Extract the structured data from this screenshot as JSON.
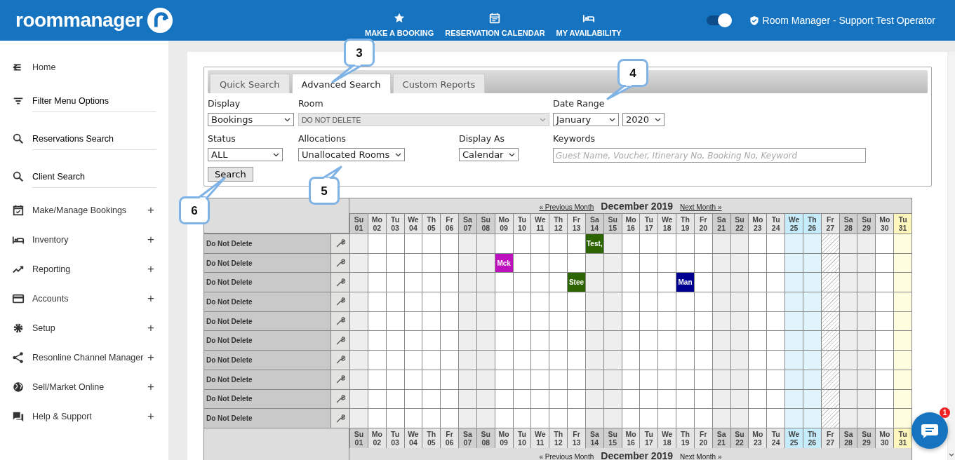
{
  "header": {
    "logo": "roommanager",
    "nav": [
      {
        "label": "MAKE A BOOKING"
      },
      {
        "label": "RESERVATION CALENDAR"
      },
      {
        "label": "MY AVAILABILITY"
      }
    ],
    "toggle": {
      "on": true
    },
    "user": "Room Manager - Support Test Operator"
  },
  "sidebar": {
    "items": [
      {
        "label": "Home",
        "kind": "plain"
      },
      {
        "label": "Filter Menu Options",
        "kind": "link"
      },
      {
        "label": "Reservations Search",
        "kind": "link"
      },
      {
        "label": "Client Search",
        "kind": "link"
      },
      {
        "label": "Make/Manage Bookings",
        "kind": "group",
        "toggle": "+"
      },
      {
        "label": "Inventory",
        "kind": "group",
        "toggle": "+"
      },
      {
        "label": "Reporting",
        "kind": "group",
        "toggle": "+"
      },
      {
        "label": "Accounts",
        "kind": "group",
        "toggle": "+"
      },
      {
        "label": "Setup",
        "kind": "group",
        "toggle": "+"
      },
      {
        "label": "Resonline Channel Manager",
        "kind": "group",
        "toggle": "+"
      },
      {
        "label": "Sell/Market Online",
        "kind": "group",
        "toggle": "+"
      },
      {
        "label": "Help & Support",
        "kind": "group",
        "toggle": "+"
      }
    ]
  },
  "tabs": [
    {
      "label": "Quick Search",
      "selected": false
    },
    {
      "label": "Advanced Search",
      "selected": true
    },
    {
      "label": "Custom Reports",
      "selected": false
    }
  ],
  "form": {
    "display": {
      "label": "Display",
      "value": "Bookings"
    },
    "room": {
      "label": "Room",
      "value": "DO NOT DELETE",
      "disabled": true
    },
    "date_range": {
      "label": "Date Range",
      "month": "January",
      "year": "2020"
    },
    "status": {
      "label": "Status",
      "value": "ALL"
    },
    "allocations": {
      "label": "Allocations",
      "value": "Unallocated Rooms"
    },
    "display_as": {
      "label": "Display As",
      "value": "Calendar"
    },
    "keywords": {
      "label": "Keywords",
      "placeholder": "Guest Name, Voucher, Itinerary No, Booking No, Keyword"
    },
    "search_button": "Search"
  },
  "calendar": {
    "nav_top": {
      "prev": "« Previous Month",
      "title": "December 2019",
      "next": "Next Month »"
    },
    "nav_bottom": {
      "prev": "« Previous Month",
      "title": "December 2019",
      "next": "Next Month »"
    },
    "days": [
      {
        "dow": "Su",
        "day": "01",
        "kind": "weekend"
      },
      {
        "dow": "Mo",
        "day": "02",
        "kind": "weekday"
      },
      {
        "dow": "Tu",
        "day": "03",
        "kind": "weekday"
      },
      {
        "dow": "We",
        "day": "04",
        "kind": "weekday"
      },
      {
        "dow": "Th",
        "day": "05",
        "kind": "weekday"
      },
      {
        "dow": "Fr",
        "day": "06",
        "kind": "weekday"
      },
      {
        "dow": "Sa",
        "day": "07",
        "kind": "weekend"
      },
      {
        "dow": "Su",
        "day": "08",
        "kind": "weekend"
      },
      {
        "dow": "Mo",
        "day": "09",
        "kind": "weekday"
      },
      {
        "dow": "Tu",
        "day": "10",
        "kind": "weekday"
      },
      {
        "dow": "We",
        "day": "11",
        "kind": "weekday"
      },
      {
        "dow": "Th",
        "day": "12",
        "kind": "weekday"
      },
      {
        "dow": "Fr",
        "day": "13",
        "kind": "weekday"
      },
      {
        "dow": "Sa",
        "day": "14",
        "kind": "weekend"
      },
      {
        "dow": "Su",
        "day": "15",
        "kind": "weekend"
      },
      {
        "dow": "Mo",
        "day": "16",
        "kind": "weekday"
      },
      {
        "dow": "Tu",
        "day": "17",
        "kind": "weekday"
      },
      {
        "dow": "We",
        "day": "18",
        "kind": "weekday"
      },
      {
        "dow": "Th",
        "day": "19",
        "kind": "weekday"
      },
      {
        "dow": "Fr",
        "day": "20",
        "kind": "weekday"
      },
      {
        "dow": "Sa",
        "day": "21",
        "kind": "weekend"
      },
      {
        "dow": "Su",
        "day": "22",
        "kind": "weekend"
      },
      {
        "dow": "Mo",
        "day": "23",
        "kind": "weekday"
      },
      {
        "dow": "Tu",
        "day": "24",
        "kind": "weekday"
      },
      {
        "dow": "We",
        "day": "25",
        "kind": "holiday"
      },
      {
        "dow": "Th",
        "day": "26",
        "kind": "holiday"
      },
      {
        "dow": "Fr",
        "day": "27",
        "kind": "closed"
      },
      {
        "dow": "Sa",
        "day": "28",
        "kind": "weekend"
      },
      {
        "dow": "Su",
        "day": "29",
        "kind": "weekend"
      },
      {
        "dow": "Mo",
        "day": "30",
        "kind": "weekday"
      },
      {
        "dow": "Tu",
        "day": "31",
        "kind": "today"
      }
    ],
    "footer_days": [
      {
        "dow": "Su",
        "day": "01"
      },
      {
        "dow": "Mo",
        "day": "02"
      },
      {
        "dow": "Tu",
        "day": "03"
      },
      {
        "dow": "We",
        "day": "04"
      },
      {
        "dow": "Th",
        "day": "05"
      },
      {
        "dow": "Fr",
        "day": "06"
      },
      {
        "dow": "Sa",
        "day": "07"
      },
      {
        "dow": "Su",
        "day": "08"
      },
      {
        "dow": "Mo",
        "day": "09"
      },
      {
        "dow": "Tu",
        "day": "10"
      },
      {
        "dow": "We",
        "day": "11"
      },
      {
        "dow": "Th",
        "day": "12"
      },
      {
        "dow": "Fr",
        "day": "13"
      },
      {
        "dow": "Sa",
        "day": "14"
      },
      {
        "dow": "Su",
        "day": "15"
      },
      {
        "dow": "Mo",
        "day": "16"
      },
      {
        "dow": "Tu",
        "day": "17"
      },
      {
        "dow": "We",
        "day": "18"
      },
      {
        "dow": "Th",
        "day": "19"
      },
      {
        "dow": "Fr",
        "day": "20"
      },
      {
        "dow": "Sa",
        "day": "21"
      },
      {
        "dow": "Su",
        "day": "22"
      },
      {
        "dow": "Mo",
        "day": "23"
      },
      {
        "dow": "Tu",
        "day": "24"
      },
      {
        "dow": "We",
        "day": "25"
      },
      {
        "dow": "Th",
        "day": "26"
      },
      {
        "dow": "Fr",
        "day": "27"
      },
      {
        "dow": "Sa",
        "day": "28"
      },
      {
        "dow": "Su",
        "day": "29"
      },
      {
        "dow": "Mo",
        "day": "30"
      },
      {
        "dow": "Tu",
        "day": "31"
      }
    ],
    "rows": [
      {
        "name": "Do Not Delete",
        "cells": [
          {
            "kind": "free"
          },
          {
            "kind": "free"
          },
          {
            "kind": "free"
          },
          {
            "kind": "free"
          },
          {
            "kind": "free"
          },
          {
            "kind": "free"
          },
          {
            "kind": "free"
          },
          {
            "kind": "free"
          },
          {
            "kind": "free"
          },
          {
            "kind": "free"
          },
          {
            "kind": "free"
          },
          {
            "kind": "free"
          },
          {
            "kind": "free"
          },
          {
            "kind": "booking",
            "label": "Test,",
            "color": "#2d6600"
          },
          {
            "kind": "free"
          },
          {
            "kind": "free"
          },
          {
            "kind": "free"
          },
          {
            "kind": "free"
          },
          {
            "kind": "free"
          },
          {
            "kind": "free"
          },
          {
            "kind": "free"
          },
          {
            "kind": "free"
          },
          {
            "kind": "free"
          },
          {
            "kind": "free"
          },
          {
            "kind": "free"
          },
          {
            "kind": "free"
          },
          {
            "kind": "free"
          },
          {
            "kind": "free"
          },
          {
            "kind": "free"
          },
          {
            "kind": "free"
          },
          {
            "kind": "free"
          }
        ]
      },
      {
        "name": "Do Not Delete",
        "cells": [
          {
            "kind": "free"
          },
          {
            "kind": "free"
          },
          {
            "kind": "free"
          },
          {
            "kind": "free"
          },
          {
            "kind": "free"
          },
          {
            "kind": "free"
          },
          {
            "kind": "free"
          },
          {
            "kind": "free"
          },
          {
            "kind": "booking",
            "label": "Mck",
            "color": "#bf10bf"
          },
          {
            "kind": "free"
          },
          {
            "kind": "free"
          },
          {
            "kind": "free"
          },
          {
            "kind": "free"
          },
          {
            "kind": "free"
          },
          {
            "kind": "free"
          },
          {
            "kind": "free"
          },
          {
            "kind": "free"
          },
          {
            "kind": "free"
          },
          {
            "kind": "free"
          },
          {
            "kind": "free"
          },
          {
            "kind": "free"
          },
          {
            "kind": "free"
          },
          {
            "kind": "free"
          },
          {
            "kind": "free"
          },
          {
            "kind": "free"
          },
          {
            "kind": "free"
          },
          {
            "kind": "free"
          },
          {
            "kind": "free"
          },
          {
            "kind": "free"
          },
          {
            "kind": "free"
          },
          {
            "kind": "free"
          }
        ]
      },
      {
        "name": "Do Not Delete",
        "cells": [
          {
            "kind": "free"
          },
          {
            "kind": "free"
          },
          {
            "kind": "free"
          },
          {
            "kind": "free"
          },
          {
            "kind": "free"
          },
          {
            "kind": "free"
          },
          {
            "kind": "free"
          },
          {
            "kind": "free"
          },
          {
            "kind": "free"
          },
          {
            "kind": "free"
          },
          {
            "kind": "free"
          },
          {
            "kind": "free"
          },
          {
            "kind": "booking",
            "label": "Stee",
            "color": "#2d6600"
          },
          {
            "kind": "free"
          },
          {
            "kind": "free"
          },
          {
            "kind": "free"
          },
          {
            "kind": "free"
          },
          {
            "kind": "free"
          },
          {
            "kind": "booking",
            "label": "Man",
            "color": "#000090"
          },
          {
            "kind": "free"
          },
          {
            "kind": "free"
          },
          {
            "kind": "free"
          },
          {
            "kind": "free"
          },
          {
            "kind": "free"
          },
          {
            "kind": "free"
          },
          {
            "kind": "free"
          },
          {
            "kind": "free"
          },
          {
            "kind": "free"
          },
          {
            "kind": "free"
          },
          {
            "kind": "free"
          },
          {
            "kind": "free"
          }
        ]
      },
      {
        "name": "Do Not Delete",
        "cells": [
          {
            "kind": "free"
          },
          {
            "kind": "free"
          },
          {
            "kind": "free"
          },
          {
            "kind": "free"
          },
          {
            "kind": "free"
          },
          {
            "kind": "free"
          },
          {
            "kind": "free"
          },
          {
            "kind": "free"
          },
          {
            "kind": "free"
          },
          {
            "kind": "free"
          },
          {
            "kind": "free"
          },
          {
            "kind": "free"
          },
          {
            "kind": "free"
          },
          {
            "kind": "free"
          },
          {
            "kind": "free"
          },
          {
            "kind": "free"
          },
          {
            "kind": "free"
          },
          {
            "kind": "free"
          },
          {
            "kind": "free"
          },
          {
            "kind": "free"
          },
          {
            "kind": "free"
          },
          {
            "kind": "free"
          },
          {
            "kind": "free"
          },
          {
            "kind": "free"
          },
          {
            "kind": "free"
          },
          {
            "kind": "free"
          },
          {
            "kind": "free"
          },
          {
            "kind": "free"
          },
          {
            "kind": "free"
          },
          {
            "kind": "free"
          },
          {
            "kind": "free"
          }
        ]
      },
      {
        "name": "Do Not Delete",
        "cells": [
          {
            "kind": "free"
          },
          {
            "kind": "free"
          },
          {
            "kind": "free"
          },
          {
            "kind": "free"
          },
          {
            "kind": "free"
          },
          {
            "kind": "free"
          },
          {
            "kind": "free"
          },
          {
            "kind": "free"
          },
          {
            "kind": "free"
          },
          {
            "kind": "free"
          },
          {
            "kind": "free"
          },
          {
            "kind": "free"
          },
          {
            "kind": "free"
          },
          {
            "kind": "free"
          },
          {
            "kind": "free"
          },
          {
            "kind": "free"
          },
          {
            "kind": "free"
          },
          {
            "kind": "free"
          },
          {
            "kind": "free"
          },
          {
            "kind": "free"
          },
          {
            "kind": "free"
          },
          {
            "kind": "free"
          },
          {
            "kind": "free"
          },
          {
            "kind": "free"
          },
          {
            "kind": "free"
          },
          {
            "kind": "free"
          },
          {
            "kind": "free"
          },
          {
            "kind": "free"
          },
          {
            "kind": "free"
          },
          {
            "kind": "free"
          },
          {
            "kind": "free"
          }
        ]
      },
      {
        "name": "Do Not Delete",
        "cells": [
          {
            "kind": "free"
          },
          {
            "kind": "free"
          },
          {
            "kind": "free"
          },
          {
            "kind": "free"
          },
          {
            "kind": "free"
          },
          {
            "kind": "free"
          },
          {
            "kind": "free"
          },
          {
            "kind": "free"
          },
          {
            "kind": "free"
          },
          {
            "kind": "free"
          },
          {
            "kind": "free"
          },
          {
            "kind": "free"
          },
          {
            "kind": "free"
          },
          {
            "kind": "free"
          },
          {
            "kind": "free"
          },
          {
            "kind": "free"
          },
          {
            "kind": "free"
          },
          {
            "kind": "free"
          },
          {
            "kind": "free"
          },
          {
            "kind": "free"
          },
          {
            "kind": "free"
          },
          {
            "kind": "free"
          },
          {
            "kind": "free"
          },
          {
            "kind": "free"
          },
          {
            "kind": "free"
          },
          {
            "kind": "free"
          },
          {
            "kind": "free"
          },
          {
            "kind": "free"
          },
          {
            "kind": "free"
          },
          {
            "kind": "free"
          },
          {
            "kind": "free"
          }
        ]
      },
      {
        "name": "Do Not Delete",
        "cells": [
          {
            "kind": "free"
          },
          {
            "kind": "free"
          },
          {
            "kind": "free"
          },
          {
            "kind": "free"
          },
          {
            "kind": "free"
          },
          {
            "kind": "free"
          },
          {
            "kind": "free"
          },
          {
            "kind": "free"
          },
          {
            "kind": "free"
          },
          {
            "kind": "free"
          },
          {
            "kind": "free"
          },
          {
            "kind": "free"
          },
          {
            "kind": "free"
          },
          {
            "kind": "free"
          },
          {
            "kind": "free"
          },
          {
            "kind": "free"
          },
          {
            "kind": "free"
          },
          {
            "kind": "free"
          },
          {
            "kind": "free"
          },
          {
            "kind": "free"
          },
          {
            "kind": "free"
          },
          {
            "kind": "free"
          },
          {
            "kind": "free"
          },
          {
            "kind": "free"
          },
          {
            "kind": "free"
          },
          {
            "kind": "free"
          },
          {
            "kind": "free"
          },
          {
            "kind": "free"
          },
          {
            "kind": "free"
          },
          {
            "kind": "free"
          },
          {
            "kind": "free"
          }
        ]
      },
      {
        "name": "Do Not Delete",
        "cells": [
          {
            "kind": "free"
          },
          {
            "kind": "free"
          },
          {
            "kind": "free"
          },
          {
            "kind": "free"
          },
          {
            "kind": "free"
          },
          {
            "kind": "free"
          },
          {
            "kind": "free"
          },
          {
            "kind": "free"
          },
          {
            "kind": "free"
          },
          {
            "kind": "free"
          },
          {
            "kind": "free"
          },
          {
            "kind": "free"
          },
          {
            "kind": "free"
          },
          {
            "kind": "free"
          },
          {
            "kind": "free"
          },
          {
            "kind": "free"
          },
          {
            "kind": "free"
          },
          {
            "kind": "free"
          },
          {
            "kind": "free"
          },
          {
            "kind": "free"
          },
          {
            "kind": "free"
          },
          {
            "kind": "free"
          },
          {
            "kind": "free"
          },
          {
            "kind": "free"
          },
          {
            "kind": "free"
          },
          {
            "kind": "free"
          },
          {
            "kind": "free"
          },
          {
            "kind": "free"
          },
          {
            "kind": "free"
          },
          {
            "kind": "free"
          },
          {
            "kind": "free"
          }
        ]
      },
      {
        "name": "Do Not Delete",
        "cells": [
          {
            "kind": "free"
          },
          {
            "kind": "free"
          },
          {
            "kind": "free"
          },
          {
            "kind": "free"
          },
          {
            "kind": "free"
          },
          {
            "kind": "free"
          },
          {
            "kind": "free"
          },
          {
            "kind": "free"
          },
          {
            "kind": "free"
          },
          {
            "kind": "free"
          },
          {
            "kind": "free"
          },
          {
            "kind": "free"
          },
          {
            "kind": "free"
          },
          {
            "kind": "free"
          },
          {
            "kind": "free"
          },
          {
            "kind": "free"
          },
          {
            "kind": "free"
          },
          {
            "kind": "free"
          },
          {
            "kind": "free"
          },
          {
            "kind": "free"
          },
          {
            "kind": "free"
          },
          {
            "kind": "free"
          },
          {
            "kind": "free"
          },
          {
            "kind": "free"
          },
          {
            "kind": "free"
          },
          {
            "kind": "free"
          },
          {
            "kind": "free"
          },
          {
            "kind": "free"
          },
          {
            "kind": "free"
          },
          {
            "kind": "free"
          },
          {
            "kind": "free"
          }
        ]
      },
      {
        "name": "Do Not Delete",
        "cells": [
          {
            "kind": "free"
          },
          {
            "kind": "free"
          },
          {
            "kind": "free"
          },
          {
            "kind": "free"
          },
          {
            "kind": "free"
          },
          {
            "kind": "free"
          },
          {
            "kind": "free"
          },
          {
            "kind": "free"
          },
          {
            "kind": "free"
          },
          {
            "kind": "free"
          },
          {
            "kind": "free"
          },
          {
            "kind": "free"
          },
          {
            "kind": "free"
          },
          {
            "kind": "free"
          },
          {
            "kind": "free"
          },
          {
            "kind": "free"
          },
          {
            "kind": "free"
          },
          {
            "kind": "free"
          },
          {
            "kind": "free"
          },
          {
            "kind": "free"
          },
          {
            "kind": "free"
          },
          {
            "kind": "free"
          },
          {
            "kind": "free"
          },
          {
            "kind": "free"
          },
          {
            "kind": "free"
          },
          {
            "kind": "free"
          },
          {
            "kind": "free"
          },
          {
            "kind": "free"
          },
          {
            "kind": "free"
          },
          {
            "kind": "free"
          },
          {
            "kind": "free"
          }
        ]
      }
    ]
  },
  "callouts": [
    {
      "label": "3"
    },
    {
      "label": "4"
    },
    {
      "label": "5"
    },
    {
      "label": "6"
    }
  ],
  "chat": {
    "badge": "1"
  }
}
